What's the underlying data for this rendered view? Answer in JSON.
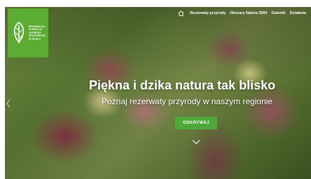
{
  "logo": {
    "lines": [
      "REGIONALNA",
      "DYREKCJA",
      "OCHRONY",
      "ŚRODOWISKA",
      "W OPOLU"
    ],
    "background": "#5cab32",
    "icon": "leaf-icon"
  },
  "nav": {
    "home_icon": "home-icon",
    "items": [
      {
        "label": "Rezerwaty przyrody"
      },
      {
        "label": "Obszary Natura 2000"
      },
      {
        "label": "Gatunki"
      },
      {
        "label": "Działania"
      }
    ]
  },
  "hero": {
    "headline": "Piękna i dzika natura tak blisko",
    "subheadline": "Poznaj rezerwaty przyrody w naszym regionie",
    "cta_label": "ODKRYWAJ",
    "cta_color": "#4fa93a",
    "prev_icon": "chevron-left-icon",
    "scroll_icon": "chevron-down-icon"
  }
}
